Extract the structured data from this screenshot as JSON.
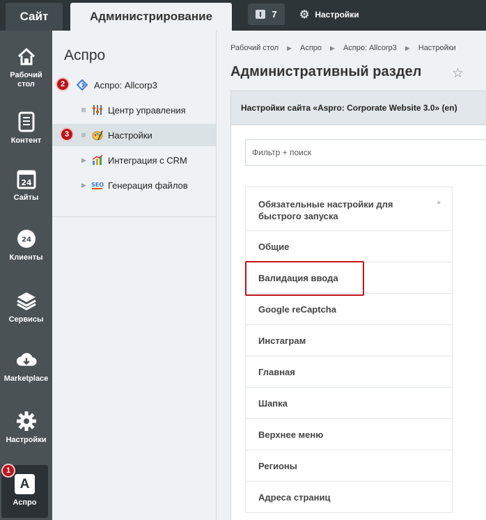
{
  "topbar": {
    "site_tab": "Сайт",
    "admin_tab": "Администрирование",
    "notifications_count": "7",
    "settings_label": "Настройки"
  },
  "iconbar": {
    "items": [
      {
        "label": "Рабочий стол",
        "icon": "home-icon"
      },
      {
        "label": "Контент",
        "icon": "document-icon"
      },
      {
        "label": "Сайты",
        "icon": "calendar-24-icon"
      },
      {
        "label": "Клиенты",
        "icon": "cloud-24-icon"
      },
      {
        "label": "Сервисы",
        "icon": "layers-icon"
      },
      {
        "label": "Marketplace",
        "icon": "cloud-download-icon"
      },
      {
        "label": "Настройки",
        "icon": "gear-icon"
      },
      {
        "label": "Аспро",
        "icon": "aspro-logo-icon"
      }
    ],
    "aspro_logo_letter": "A",
    "badge_1": "1"
  },
  "menu": {
    "title": "Аспро",
    "badge_2": "2",
    "badge_3": "3",
    "items": [
      {
        "label": "Аспро: Allcorp3"
      },
      {
        "label": "Центр управления"
      },
      {
        "label": "Настройки"
      },
      {
        "label": "Интеграция с CRM"
      },
      {
        "label": "Генерация файлов"
      }
    ]
  },
  "main": {
    "breadcrumbs": [
      "Рабочий стол",
      "Аспро",
      "Аспро: Allcorp3",
      "Настройки"
    ],
    "title": "Административный раздел",
    "panel_title": "Настройки сайта «Aspro: Corporate Website 3.0» (en)",
    "filter_placeholder": "Фильтр + поиск",
    "required_mark": "*",
    "sections": [
      "Обязательные настройки для быстрого запуска",
      "Общие",
      "Валидация ввода",
      "Google reCaptcha",
      "Инстаграм",
      "Главная",
      "Шапка",
      "Верхнее меню",
      "Регионы",
      "Адреса страниц"
    ]
  },
  "colors": {
    "topbar_bg": "#2e3538",
    "sidebar_bg": "#4a5256",
    "badge": "#b6161b",
    "highlight": "#c0141a"
  }
}
